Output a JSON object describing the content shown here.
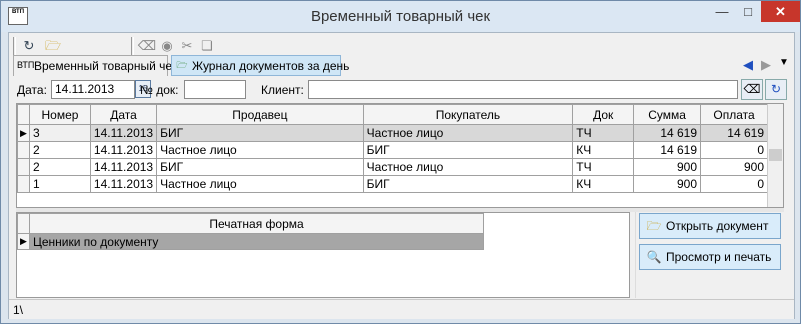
{
  "window": {
    "title": "Временный товарный чек",
    "app_icon_text": "ВТП"
  },
  "tabs": [
    {
      "label": "Временный товарный чек",
      "icon": "vtp-icon"
    },
    {
      "label": "Журнал документов за день",
      "icon": "folder-icon"
    }
  ],
  "filter": {
    "date_label": "Дата:",
    "date_value": "14.11.2013",
    "calendar_day": "15",
    "doc_label": "№ док:",
    "doc_value": "",
    "client_label": "Клиент:",
    "client_value": ""
  },
  "grid": {
    "columns": [
      "Номер",
      "Дата",
      "Продавец",
      "Покупатель",
      "Док",
      "Сумма",
      "Оплата"
    ],
    "rows": [
      {
        "num": "3",
        "date": "14.11.2013",
        "seller": "БИГ",
        "buyer": "Частное лицо",
        "doc": "ТЧ",
        "sum": "14 619",
        "paid": "14 619"
      },
      {
        "num": "2",
        "date": "14.11.2013",
        "seller": "Частное лицо",
        "buyer": "БИГ",
        "doc": "КЧ",
        "sum": "14 619",
        "paid": "0"
      },
      {
        "num": "2",
        "date": "14.11.2013",
        "seller": "БИГ",
        "buyer": "Частное лицо",
        "doc": "ТЧ",
        "sum": "900",
        "paid": "900"
      },
      {
        "num": "1",
        "date": "14.11.2013",
        "seller": "Частное лицо",
        "buyer": "БИГ",
        "doc": "КЧ",
        "sum": "900",
        "paid": "0"
      }
    ]
  },
  "print_grid": {
    "header": "Печатная форма",
    "rows": [
      "Ценники по документу"
    ]
  },
  "actions": {
    "open_label": "Открыть документ",
    "preview_label": "Просмотр и печать"
  },
  "status": {
    "text": "1\\"
  },
  "colors": {
    "close_button": "#c7362b",
    "tab_active": "#cfe6f6",
    "selection": "#a6a6a6"
  }
}
